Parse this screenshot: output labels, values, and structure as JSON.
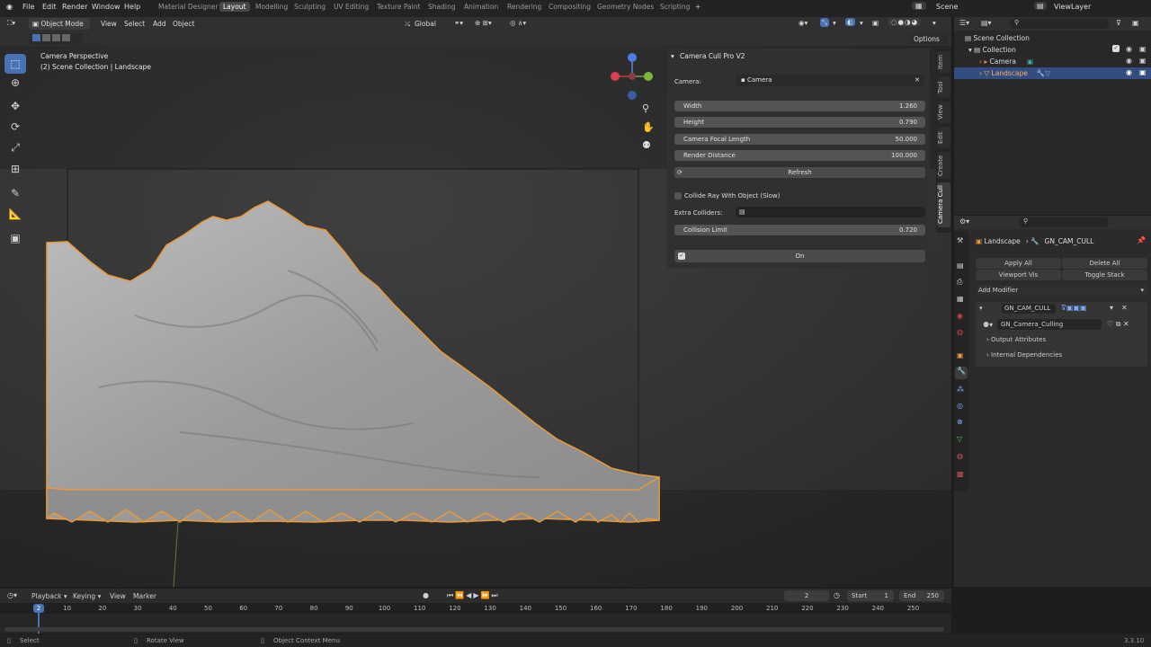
{
  "menu": [
    "File",
    "Edit",
    "Render",
    "Window",
    "Help"
  ],
  "workspaces": [
    "Material Designer",
    "Layout",
    "Modelling",
    "Sculpting",
    "UV Editing",
    "Texture Paint",
    "Shading",
    "Animation",
    "Rendering",
    "Compositing",
    "Geometry Nodes",
    "Scripting"
  ],
  "active_workspace": "Layout",
  "scene": "Scene",
  "view_layer": "ViewLayer",
  "header": {
    "mode": "Object Mode",
    "menus": [
      "View",
      "Select",
      "Add",
      "Object"
    ],
    "transform": "Global",
    "options": "Options"
  },
  "viewport": {
    "title": "Camera Perspective",
    "subtitle": "(2) Scene Collection | Landscape"
  },
  "cull_panel": {
    "title": "Camera Cull Pro V2",
    "camera_label": "Camera:",
    "camera_value": "Camera",
    "fields": [
      {
        "label": "Width",
        "value": "1.260"
      },
      {
        "label": "Height",
        "value": "0.790"
      },
      {
        "label": "Camera Focal Length",
        "value": "50.000"
      },
      {
        "label": "Render Distance",
        "value": "100.000"
      }
    ],
    "refresh": "Refresh",
    "collide_label": "Collide Ray With Object (Slow)",
    "extra_colliders_label": "Extra Colliders:",
    "collision_limit_label": "Collision Limit",
    "collision_limit_value": "0.720",
    "on_label": "On"
  },
  "sidebar_tabs": [
    "Item",
    "Tool",
    "View",
    "Edit",
    "Create",
    "Camera Cull"
  ],
  "outliner": {
    "root": "Scene Collection",
    "collection": "Collection",
    "items": [
      "Camera",
      "Landscape"
    ]
  },
  "properties": {
    "breadcrumb_object": "Landscape",
    "breadcrumb_modifier": "GN_CAM_CULL",
    "apply_all": "Apply All",
    "delete_all": "Delete All",
    "viewport_vis": "Viewport Vis",
    "toggle_stack": "Toggle Stack",
    "add_modifier": "Add Modifier",
    "modifier_name": "GN_CAM_CULL",
    "node_group": "GN_Camera_Culling",
    "sections": [
      "Output Attributes",
      "Internal Dependencies"
    ]
  },
  "timeline": {
    "menus": [
      "Playback",
      "Keying",
      "View",
      "Marker"
    ],
    "current_frame": "2",
    "start_label": "Start",
    "start_value": "1",
    "end_label": "End",
    "end_value": "250",
    "ticks": [
      "10",
      "20",
      "30",
      "40",
      "50",
      "60",
      "70",
      "80",
      "90",
      "100",
      "110",
      "120",
      "130",
      "140",
      "150",
      "160",
      "170",
      "180",
      "190",
      "200",
      "210",
      "220",
      "230",
      "240",
      "250"
    ],
    "playhead": "2"
  },
  "status": {
    "select": "Select",
    "rotate": "Rotate View",
    "context": "Object Context Menu",
    "version": "3.3.10"
  },
  "colors": {
    "accent": "#4772b3",
    "selection_outline": "#e89a3c",
    "active_tab": "#474747"
  }
}
